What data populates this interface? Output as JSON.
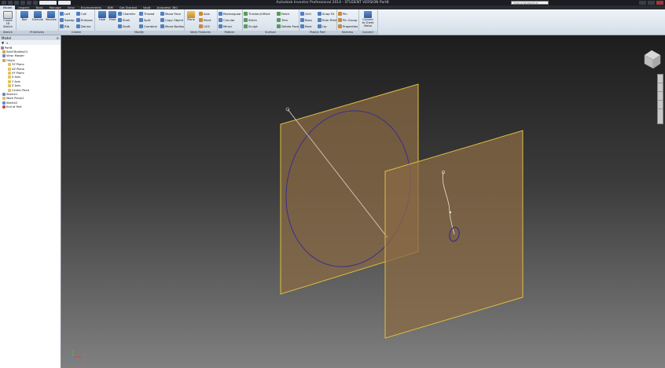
{
  "window": {
    "title": "Autodesk Inventor Professional 2014 - STUDENT VERSION    Part8",
    "search_placeholder": "Type a keyword or phrase"
  },
  "tabs": [
    "Model",
    "Inspect",
    "Tools",
    "Manage",
    "View",
    "Environments",
    "BIM",
    "Get Started",
    "Vault",
    "Autodesk 360"
  ],
  "ribbon": {
    "sketch": {
      "label": "Sketch",
      "create_2d": "Create 2D Sketch"
    },
    "primitives": {
      "label": "Primitives",
      "box": "Box",
      "extrude": "Extrude",
      "revolve": "Revolve"
    },
    "create": {
      "label": "Create",
      "items": [
        "Loft",
        "Coil",
        "Sweep",
        "Emboss",
        "Rib",
        "Derive"
      ]
    },
    "modify": {
      "label": "Modify",
      "hole": "Hole",
      "fillet": "Fillet",
      "items": [
        "Chamfer",
        "Thread",
        "Move Face",
        "Shell",
        "Split",
        "Copy Object",
        "Draft",
        "Combine",
        "Move Bodies"
      ]
    },
    "work_features": {
      "label": "Work Features",
      "plane": "Plane",
      "items": [
        "Axis",
        "Point",
        "UCS"
      ]
    },
    "pattern": {
      "label": "Pattern",
      "items": [
        "Rectangular",
        "Circular",
        "Mirror"
      ]
    },
    "surface": {
      "label": "Surface",
      "items": [
        "Thicken/Offset",
        "Patch",
        "Stitch",
        "Trim",
        "Sculpt",
        "Delete Face"
      ]
    },
    "plastic_part": {
      "label": "Plastic Part",
      "items": [
        "Grill",
        "Snap Fit",
        "Boss",
        "Rule Fillet",
        "Rest",
        "Lip"
      ]
    },
    "harness": {
      "label": "Harness",
      "items": [
        "Pin",
        "Pin Group",
        "Properties"
      ]
    },
    "convert": {
      "label": "Convert",
      "item": "Convert to Sheet Metal"
    }
  },
  "browser": {
    "title": "Model",
    "tree": [
      {
        "label": "Part8",
        "level": 0,
        "icon": "part-icon"
      },
      {
        "label": "Solid Bodies(0)",
        "level": 1,
        "icon": "folder-icon"
      },
      {
        "label": "View: Master",
        "level": 1,
        "icon": "view-icon"
      },
      {
        "label": "Origin",
        "level": 1,
        "icon": "folder-icon"
      },
      {
        "label": "YZ Plane",
        "level": 2,
        "icon": "plane-icon"
      },
      {
        "label": "XZ Plane",
        "level": 2,
        "icon": "plane-icon"
      },
      {
        "label": "XY Plane",
        "level": 2,
        "icon": "plane-icon"
      },
      {
        "label": "X Axis",
        "level": 2,
        "icon": "axis-icon"
      },
      {
        "label": "Y Axis",
        "level": 2,
        "icon": "axis-icon"
      },
      {
        "label": "Z Axis",
        "level": 2,
        "icon": "axis-icon"
      },
      {
        "label": "Center Point",
        "level": 2,
        "icon": "point-icon"
      },
      {
        "label": "Sketch1",
        "level": 1,
        "icon": "sketch-icon"
      },
      {
        "label": "Work Plane1",
        "level": 1,
        "icon": "plane-icon"
      },
      {
        "label": "Sketch2",
        "level": 1,
        "icon": "sketch-icon"
      },
      {
        "label": "End of Part",
        "level": 1,
        "icon": "end-icon"
      }
    ]
  },
  "colors": {
    "plane_fill": "#8a6a45",
    "plane_edge": "#e0c040",
    "sketch_curve": "#3a2e8c",
    "sketch_line": "#ddd8c0"
  }
}
